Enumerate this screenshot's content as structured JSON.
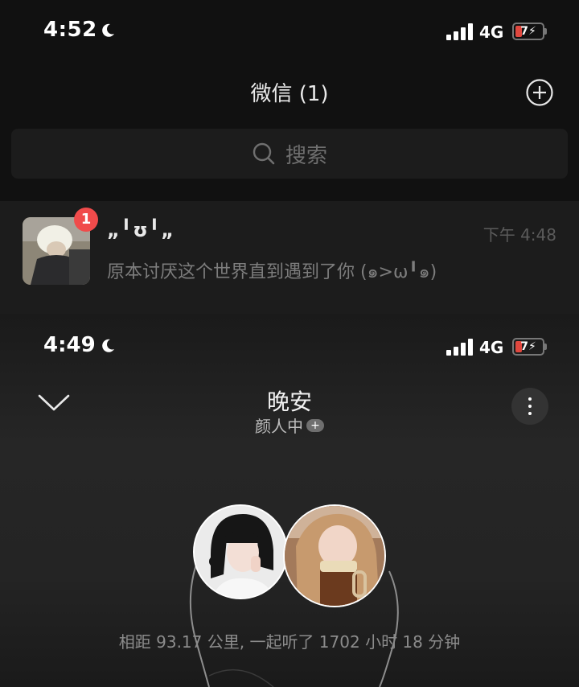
{
  "wechat": {
    "status": {
      "time": "4:52",
      "network": "4G",
      "battery": "7"
    },
    "title": "微信 (1)",
    "search_placeholder": "搜索",
    "chat": {
      "name": "„╹ʊ╹„",
      "time": "下午 4:48",
      "message": "原本讨厌这个世界直到遇到了你 (๑>ω╹๑)",
      "unread": "1"
    },
    "icons": [
      "moon-icon",
      "signal-icon",
      "battery-icon",
      "add-circle-icon",
      "search-icon"
    ]
  },
  "listen": {
    "status": {
      "time": "4:49",
      "network": "4G",
      "battery": "7"
    },
    "title": "晚安",
    "subtitle": "颜人中",
    "subtitle_badge": "+",
    "stats": "相距 93.17 公里, 一起听了 1702 小时 18 分钟",
    "icons": [
      "chevron-down-icon",
      "more-vertical-icon",
      "earphone-cord-icon"
    ]
  },
  "colors": {
    "background": "#111111",
    "panel": "#1c1c1c",
    "badge": "#f04b4b",
    "battery_low": "#e0483f",
    "muted_text": "#7d7d7d"
  }
}
